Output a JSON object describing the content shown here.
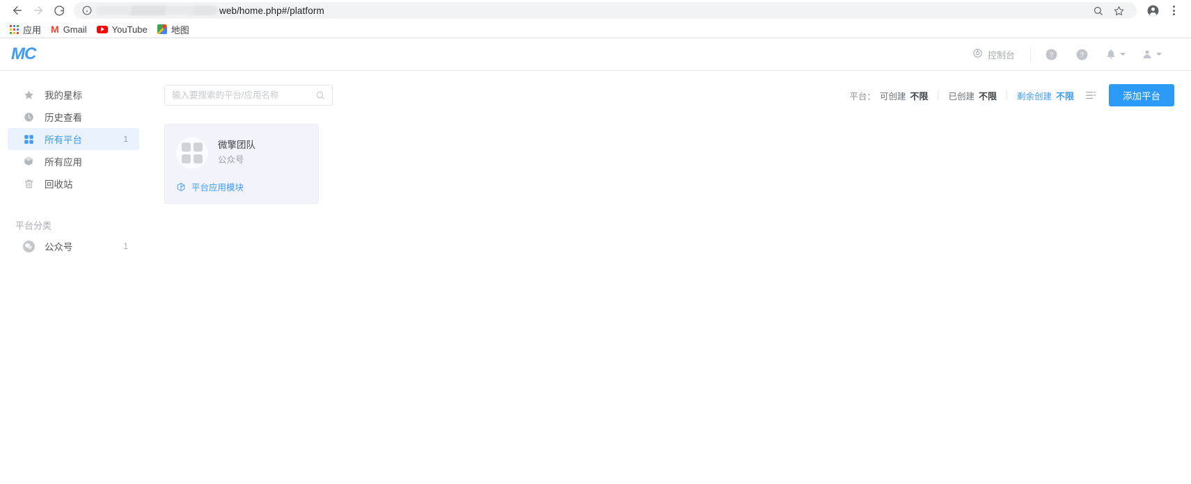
{
  "browser": {
    "nav": {
      "back_icon": "arrow-left-icon",
      "forward_icon": "arrow-right-icon",
      "reload_icon": "reload-icon"
    },
    "omnibox": {
      "info_icon": "page-info-icon",
      "url_visible": "web/home.php#/platform",
      "url_redacted": true
    },
    "actions": {
      "search_icon": "search-icon",
      "bookmark_icon": "star-icon",
      "profile_icon": "profile-avatar-icon",
      "menu_icon": "three-dot-menu-icon"
    },
    "bookmarks": [
      {
        "label": "应用",
        "icon": "apps-grid-icon"
      },
      {
        "label": "Gmail",
        "icon": "gmail-icon"
      },
      {
        "label": "YouTube",
        "icon": "youtube-icon"
      },
      {
        "label": "地图",
        "icon": "google-maps-icon"
      }
    ]
  },
  "header": {
    "logo_text": "MC",
    "console_label": "控制台",
    "console_icon": "target-icon",
    "help_icon_1": "help-circle-icon",
    "help_icon_2": "question-circle-icon",
    "bell_icon": "bell-icon",
    "user_icon": "user-icon"
  },
  "sidebar": {
    "items": [
      {
        "label": "我的星标",
        "icon": "star-icon",
        "count": "",
        "active": false
      },
      {
        "label": "历史查看",
        "icon": "clock-icon",
        "count": "",
        "active": false
      },
      {
        "label": "所有平台",
        "icon": "grid-icon",
        "count": "1",
        "active": true
      },
      {
        "label": "所有应用",
        "icon": "cube-icon",
        "count": "",
        "active": false
      },
      {
        "label": "回收站",
        "icon": "trash-icon",
        "count": "",
        "active": false
      }
    ],
    "section_title": "平台分类",
    "categories": [
      {
        "label": "公众号",
        "icon": "wechat-icon",
        "count": "1"
      }
    ]
  },
  "main": {
    "search": {
      "placeholder": "输入要搜索的平台/应用名称",
      "value": "",
      "icon": "search-icon"
    },
    "quota": {
      "prefix": "平台：",
      "items": [
        {
          "name": "可创建",
          "value": "不限",
          "highlight": false
        },
        {
          "name": "已创建",
          "value": "不限",
          "highlight": false
        },
        {
          "name": "剩余创建",
          "value": "不限",
          "highlight": true
        }
      ]
    },
    "list_toggle_icon": "list-view-icon",
    "add_button": "添加平台",
    "cards": [
      {
        "title": "微擎团队",
        "subtitle": "公众号",
        "link_label": "平台应用模块",
        "link_icon": "cube-icon",
        "avatar_icon": "grid-placeholder-icon"
      }
    ]
  },
  "colors": {
    "accent": "#3d9bf5",
    "button": "#2c9bf7",
    "active_bg": "#e9f2fd",
    "card_bg": "#f3f4fb"
  }
}
